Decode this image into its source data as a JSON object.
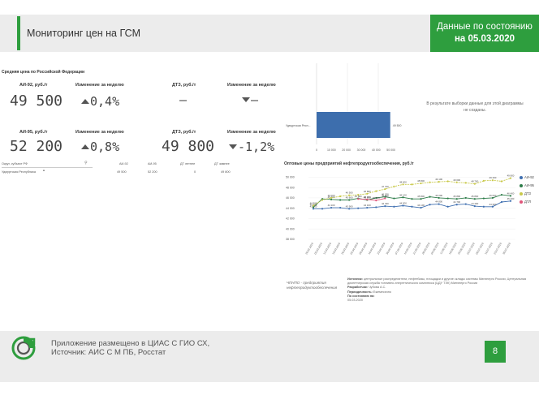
{
  "header": {
    "title": "Мониторинг цен на ГСМ",
    "date_line1": "Данные по состоянию",
    "date_line2": "на 05.03.2020"
  },
  "section_title": "Средняя цена по Российской Федерации",
  "metrics": {
    "ai92_label": "АИ-92, руб./т",
    "ai92_value": "49 500",
    "ai92_change_label": "Изменение за неделю",
    "ai92_change": "0,4%",
    "dt_label": "ДТЗ, руб./т",
    "dt_value": "–",
    "dt_change_label": "Изменение за неделю",
    "dt_change": "–",
    "ai95_label": "АИ-95, руб./т",
    "ai95_value": "52 200",
    "ai95_change_label": "Изменение за неделю",
    "ai95_change": "0,8%",
    "dt3_label": "ДТЗ, руб./т",
    "dt3_value": "49 800",
    "dt3_change_label": "Изменение за неделю",
    "dt3_change": "-1,2%"
  },
  "mini_table": {
    "col0": "Округ, субъект РФ",
    "col1": "АИ-92",
    "col2": "АИ-95",
    "col3": "ДТ летнее",
    "col4": "ДТ зимнее",
    "row_region": "Удмуртская Республика",
    "row_v1": "49 500",
    "row_v2": "52 200",
    "row_v3": "0",
    "row_v4": "49 800"
  },
  "no_data_text": "В результате выборки данные для этой диаграммы не созданы.",
  "opt_title": "Оптовые цены предприятий нефтепродуктообеспечения, руб./т",
  "legend": {
    "ai92": "АИ-92",
    "ai95": "АИ-95",
    "dtz": "ДТЗ",
    "dtl": "ДТЛ"
  },
  "colors": {
    "brand": "#2e9e3e",
    "ai92": "#3f6fb0",
    "ai95": "#2e7d4a",
    "dtz": "#c9c94a",
    "dtl": "#e0557a"
  },
  "note_left": "ЧПНПО - предприятия нефтепродуктообеспечения",
  "note_right": {
    "source_label": "Источник:",
    "source_text": "центральные распределители, нефтебазы, площадки и другие склады системы Минэнерго России, Центральная диспетчерская служба топливно-энергетического комплекса (ЦДУ ТЭК) Минэнерго России",
    "dev_label": "Разработчик:",
    "dev_text": "Чубова А.С.",
    "period_label": "Периодичность:",
    "period_text": "Ежемесячно",
    "date_label": "По состоянию на:",
    "date_text": "05.03.2020"
  },
  "footer": {
    "line1": "Приложение размещено в ЦИАС С ГИО СХ,",
    "line2": "Источник: АИС С М ПБ, Росстат",
    "page": "8"
  },
  "chart_data": [
    {
      "type": "bar",
      "orientation": "horizontal",
      "categories": [
        "Удмуртская Респ..."
      ],
      "values": [
        49500
      ],
      "data_labels": [
        "49 500"
      ],
      "xlim": [
        0,
        60000
      ],
      "x_ticks": [
        "0",
        "10 000",
        "20 000",
        "30 000",
        "40 000",
        "50 000"
      ]
    },
    {
      "type": "line",
      "title": "Оптовые цены предприятий нефтепродуктообеспечения, руб./т",
      "ylim": [
        38000,
        51000
      ],
      "y_ticks": [
        "38 000",
        "40 000",
        "42 000",
        "44 000",
        "46 000",
        "48 000",
        "50 000"
      ],
      "x": [
        "26.02.2019",
        "05.03.2019",
        "12.03.2019",
        "19.03.2019",
        "26.03.2019",
        "02.04.2019",
        "09.04.2019",
        "16.04.2019",
        "23.04.2019",
        "30.04.2019",
        "07.05.2019",
        "14.05.2019",
        "21.05.2019",
        "28.05.2019",
        "04.06.2019",
        "11.06.2019",
        "18.06.2019",
        "25.06.2019",
        "02.07.2019",
        "09.07.2019",
        "16.07.2019",
        "23.07.2019",
        "30.07.2019"
      ],
      "series": [
        {
          "name": "АИ-92",
          "values": [
            43900,
            43900,
            44100,
            44100,
            43900,
            44000,
            44100,
            44200,
            44400,
            44300,
            44500,
            44300,
            44100,
            44700,
            44800,
            44300,
            44700,
            44800,
            44400,
            44300,
            44300,
            45200,
            45400
          ]
        },
        {
          "name": "АИ-95",
          "values": [
            44200,
            45800,
            45700,
            45600,
            45600,
            45900,
            45600,
            46000,
            46200,
            45900,
            46100,
            45800,
            45800,
            46200,
            46000,
            45900,
            45800,
            46000,
            45800,
            45900,
            46000,
            46600,
            46400
          ]
        },
        {
          "name": "ДТЗ",
          "values": [
            44500,
            45600,
            46000,
            46300,
            46500,
            46600,
            46800,
            47300,
            47700,
            48200,
            48600,
            48600,
            48800,
            49000,
            49100,
            49200,
            49000,
            48900,
            48700,
            49300,
            49400,
            49200,
            49800
          ]
        },
        {
          "name": "ДТЛ",
          "values": [
            null,
            null,
            null,
            null,
            null,
            45800,
            45700,
            45500,
            45900,
            null,
            null,
            null,
            null,
            null,
            null,
            null,
            null,
            null,
            null,
            null,
            null,
            null,
            null
          ]
        }
      ]
    }
  ]
}
